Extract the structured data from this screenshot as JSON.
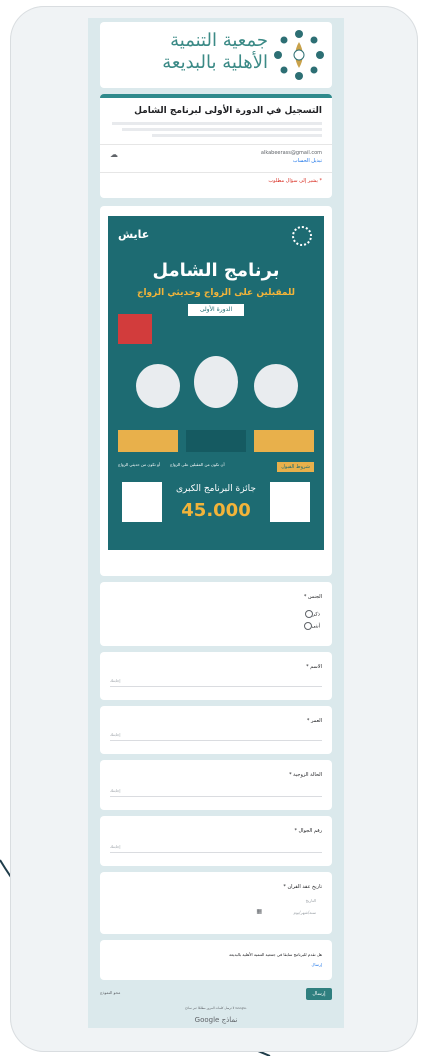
{
  "banner": {
    "org_line1": "جمعية التنمية",
    "org_line2": "الأهلية بالبديعة"
  },
  "header": {
    "title": "التسجيل في الدورة الأولى لبرنامج الشامل",
    "email": "alkabeerass@gmail.com",
    "switch_account": "تبديل الحساب",
    "required_note": "* يشير إلى سؤال مطلوب"
  },
  "poster": {
    "brand": "عايش",
    "headline": "برنامج الشامل",
    "subheadline": "للمقبلين على الزواج وحديثي الزواج",
    "course": "الدورة الأولى",
    "prize_label": "جائزة البرنامج الكبرى",
    "prize_value": "45.000",
    "conditions_title": "شروط القبول",
    "condition_a": "أن تكون من المقبلين على الزواج",
    "condition_b": "أو تكون من حديثي الزواج"
  },
  "questions": [
    {
      "title": "الجنس *",
      "options": [
        "ذكر",
        "أنثى"
      ]
    },
    {
      "title": "الاسم *",
      "placeholder": "إجابتك"
    },
    {
      "title": "العمر *",
      "placeholder": "إجابتك"
    },
    {
      "title": "الحالة الزوجية *",
      "placeholder": "إجابتك"
    },
    {
      "title": "رقم الجوال *",
      "placeholder": "إجابتك"
    },
    {
      "title": "تاريخ عقد القران *",
      "date_label": "التاريخ",
      "date_ph": "سنة/شهر/يوم"
    }
  ],
  "consent": {
    "text": "هل تقدم للبرنامج سابقا في جمعية التنمية الأهلية بالبديعة",
    "link": "إرسال"
  },
  "footer": {
    "submit": "إرسال",
    "clear": "محو النموذج",
    "note": "لا ترسل كلمات المرور مطلقًا عبر نماذج Google.",
    "google": "Google نماذج"
  }
}
